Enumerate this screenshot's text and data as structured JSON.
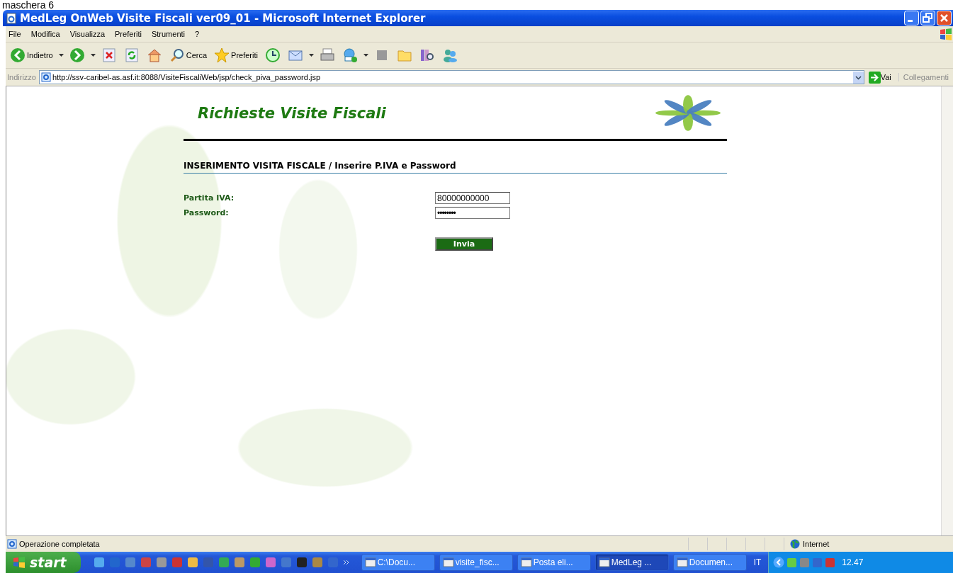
{
  "caption": "maschera 6",
  "window": {
    "title": "MedLeg OnWeb Visite Fiscali ver09_01 - Microsoft Internet Explorer"
  },
  "menu": [
    "File",
    "Modifica",
    "Visualizza",
    "Preferiti",
    "Strumenti",
    "?"
  ],
  "toolbar": [
    {
      "kind": "back",
      "label": "Indietro"
    },
    {
      "kind": "forward"
    },
    {
      "kind": "stop"
    },
    {
      "kind": "refresh"
    },
    {
      "kind": "home"
    },
    {
      "kind": "search",
      "label": "Cerca"
    },
    {
      "kind": "favorites",
      "label": "Preferiti"
    },
    {
      "kind": "history"
    },
    {
      "kind": "mail"
    },
    {
      "kind": "print"
    },
    {
      "kind": "messenger"
    },
    {
      "kind": "square"
    },
    {
      "kind": "folder"
    },
    {
      "kind": "research"
    },
    {
      "kind": "people"
    }
  ],
  "address": {
    "label": "Indirizzo",
    "value": "http://ssv-caribel-as.asf.it:8088/VisiteFiscaliWeb/jsp/check_piva_password.jsp",
    "go": "Vai",
    "links": "Collegamenti"
  },
  "page": {
    "title": "Richieste Visite Fiscali",
    "section": "INSERIMENTO VISITA FISCALE / Inserire P.IVA e Password",
    "fields": [
      {
        "label": "Partita IVA:",
        "kind": "text",
        "value": "80000000000"
      },
      {
        "label": "Password:",
        "kind": "password",
        "value": "••••••••"
      }
    ],
    "submit": "Invia"
  },
  "status_bar": {
    "text": "Operazione completata",
    "zone": "Internet"
  },
  "taskbar": {
    "start": "start",
    "buttons": [
      {
        "label": "C:\\Docu...",
        "selected": false
      },
      {
        "label": "visite_fisc...",
        "selected": false
      },
      {
        "label": "Posta eli...",
        "selected": false
      },
      {
        "label": "MedLeg ...",
        "selected": true
      },
      {
        "label": "Documen...",
        "selected": false
      }
    ],
    "language": "IT",
    "clock": "12.47"
  }
}
